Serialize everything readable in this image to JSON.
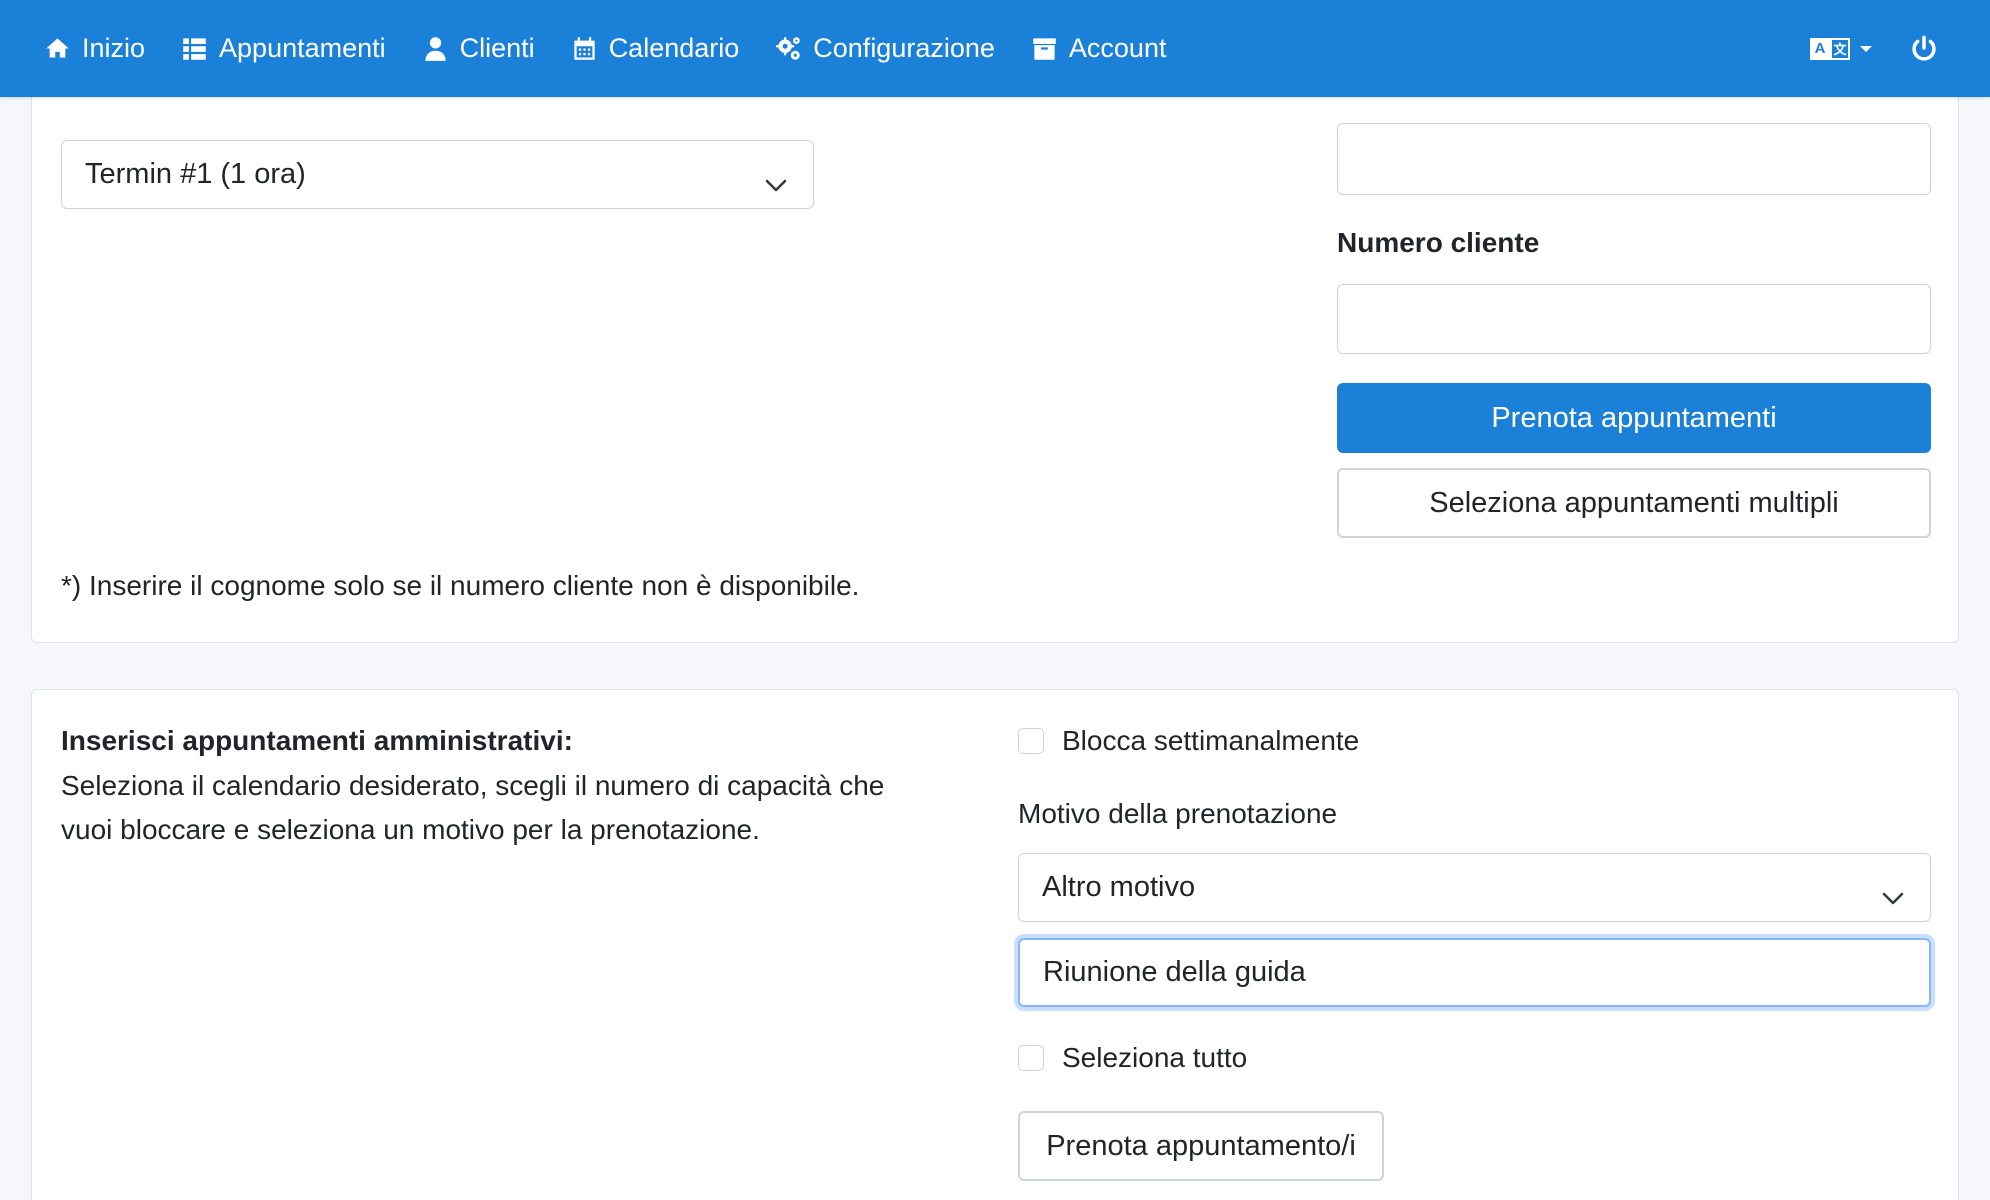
{
  "nav": {
    "items": [
      {
        "label": "Inizio",
        "icon": "home-icon"
      },
      {
        "label": "Appuntamenti",
        "icon": "list-icon"
      },
      {
        "label": "Clienti",
        "icon": "user-icon"
      },
      {
        "label": "Calendario",
        "icon": "calendar-icon"
      },
      {
        "label": "Configurazione",
        "icon": "gears-icon"
      },
      {
        "label": "Account",
        "icon": "archive-icon"
      }
    ],
    "language_icon": "language-icon",
    "logout_icon": "power-icon"
  },
  "booking": {
    "appointment_select_value": "Termin #1 (1 ora)",
    "customer_number_label": "Numero cliente",
    "book_button": "Prenota appuntamenti",
    "multi_select_button": "Seleziona appuntamenti multipli",
    "footnote": "*) Inserire il cognome solo se il numero cliente non è disponibile."
  },
  "admin": {
    "heading": "Inserisci appuntamenti amministrativi:",
    "description_line1": "Seleziona il calendario desiderato, scegli il numero di capacità che",
    "description_line2": "vuoi bloccare e seleziona un motivo per la prenotazione.",
    "weekly_block_label": "Blocca settimanalmente",
    "reason_label": "Motivo della prenotazione",
    "reason_select_value": "Altro motivo",
    "reason_text_value": "Riunione della guida",
    "select_all_label": "Seleziona tutto",
    "book_button": "Prenota appuntamento/i"
  },
  "colors": {
    "primary": "#1b80d8",
    "focus_ring": "#86b7fe"
  }
}
